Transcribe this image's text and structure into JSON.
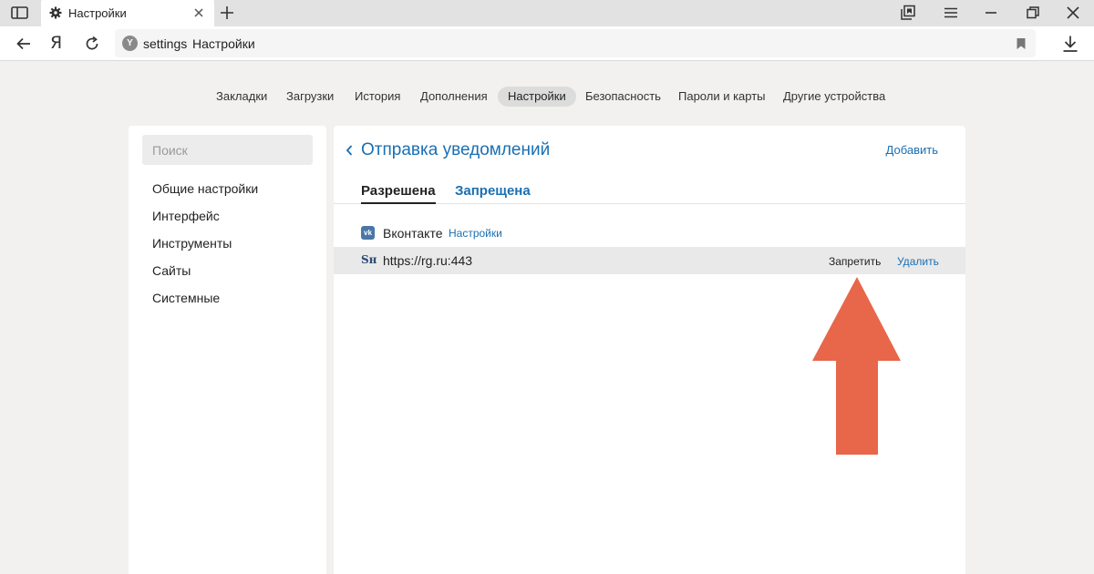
{
  "browser": {
    "tab_title": "Настройки",
    "address": {
      "scheme": "settings",
      "title": "Настройки"
    },
    "yandex_button": "Я"
  },
  "topnav": {
    "items": [
      "Закладки",
      "Загрузки",
      "История",
      "Дополнения",
      "Настройки",
      "Безопасность",
      "Пароли и карты",
      "Другие устройства"
    ],
    "active": "Настройки"
  },
  "sidebar": {
    "search_placeholder": "Поиск",
    "items": [
      "Общие настройки",
      "Интерфейс",
      "Инструменты",
      "Сайты",
      "Системные"
    ]
  },
  "main": {
    "title": "Отправка уведомлений",
    "add_label": "Добавить",
    "tabs": [
      "Разрешена",
      "Запрещена"
    ],
    "active_tab": "Разрешена",
    "sites": [
      {
        "name": "Вконтакте",
        "settings_label": "Настройки",
        "favicon": "vk-icon"
      },
      {
        "name": "https://rg.ru:443",
        "block_label": "Запретить",
        "remove_label": "Удалить",
        "favicon": "rg-icon",
        "highlighted": true
      }
    ]
  },
  "annotation": {
    "arrow_color": "#e8664a",
    "arrow_points_to": "Запретить"
  },
  "colors": {
    "link": "#1a6fb3",
    "background": "#f2f1ef",
    "tabbar": "#e2e2e2"
  }
}
